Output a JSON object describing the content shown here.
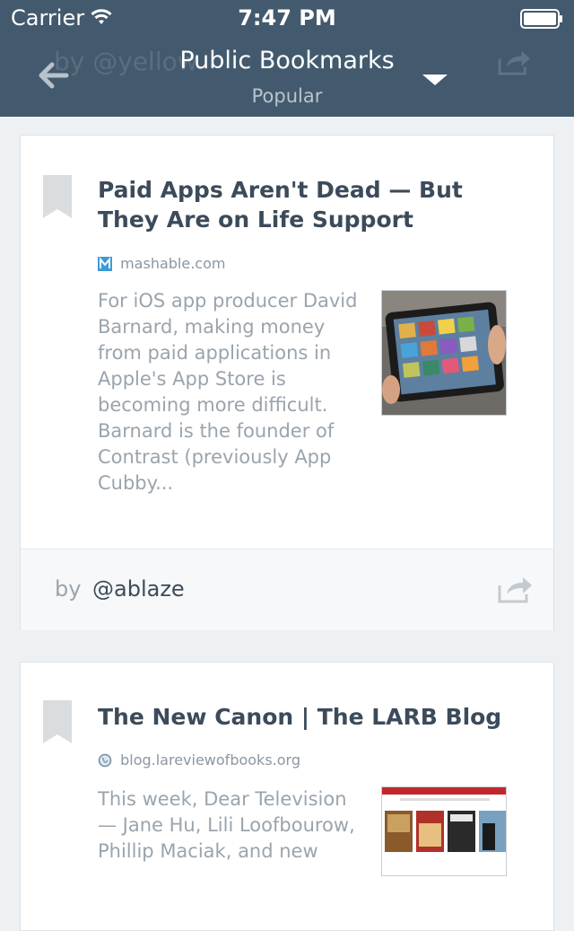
{
  "status_bar": {
    "carrier": "Carrier",
    "time": "7:47 PM"
  },
  "header": {
    "title": "Public Bookmarks",
    "subtitle": "Popular",
    "ghost_byline": "by  @yellow"
  },
  "icons": {
    "wifi": "wifi-icon",
    "battery": "battery-icon",
    "back": "back-arrow-icon",
    "dropdown": "triangle-down-icon",
    "bookmark": "bookmark-ribbon-icon",
    "share": "share-icon",
    "favicon_mashable": "mashable-favicon-icon",
    "favicon_globe": "globe-icon"
  },
  "bookmarks": [
    {
      "title": "Paid Apps Aren't Dead — But They Are on Life Support",
      "source": "mashable.com",
      "excerpt": "For iOS app producer David Barnard, making money from paid applications in Apple's App Store is becoming more difficult. Barnard is the founder of Contrast (previously App Cubby...",
      "by_label": "by",
      "user": "@ablaze"
    },
    {
      "title": "The New Canon | The LARB Blog",
      "source": "blog.lareviewofbooks.org",
      "excerpt": "This week, Dear Television — Jane Hu, Lili Loofbourow, Phillip Maciak, and new"
    }
  ],
  "colors": {
    "header_bg": "#435a6e",
    "page_bg": "#eef1f3",
    "title_text": "#3c4b5a",
    "muted_text": "#9aa4ad"
  }
}
